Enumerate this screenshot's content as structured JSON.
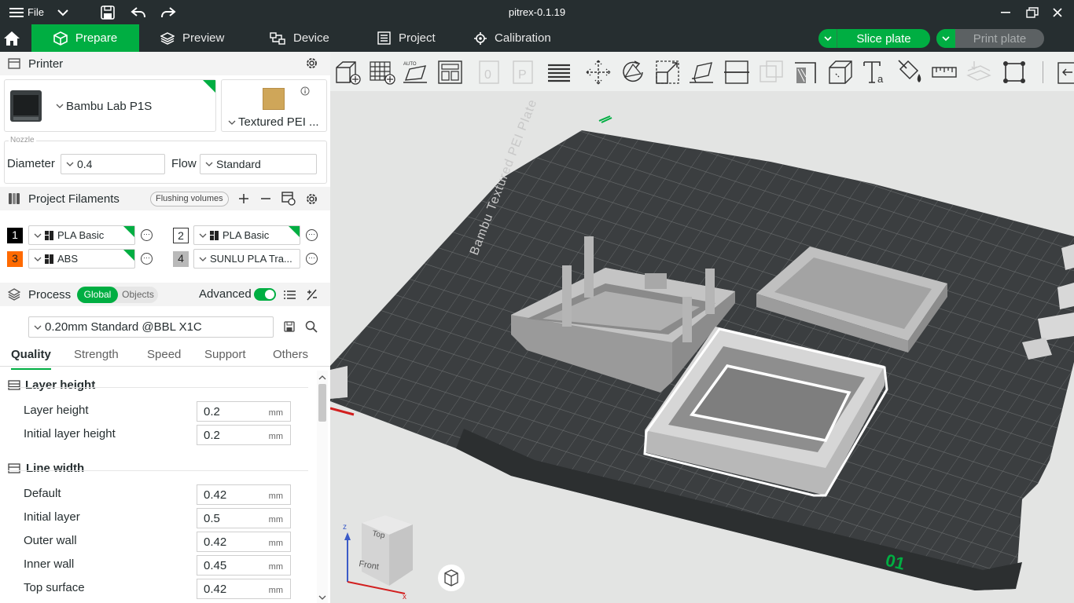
{
  "titlebar": {
    "file_label": "File",
    "title": "pitrex-0.1.19"
  },
  "tabs": {
    "prepare": "Prepare",
    "preview": "Preview",
    "device": "Device",
    "project": "Project",
    "calibration": "Calibration"
  },
  "actions": {
    "slice": "Slice plate",
    "print": "Print plate"
  },
  "printer": {
    "header": "Printer",
    "name": "Bambu Lab P1S",
    "plate": "Textured PEI ...",
    "nozzle_legend": "Nozzle",
    "diameter_label": "Diameter",
    "diameter": "0.4",
    "flow_label": "Flow",
    "flow": "Standard"
  },
  "filaments": {
    "header": "Project Filaments",
    "flushing": "Flushing volumes",
    "items": [
      {
        "num": "1",
        "name": "PLA Basic",
        "color": "#000000"
      },
      {
        "num": "2",
        "name": "PLA Basic",
        "color": "#ffffff"
      },
      {
        "num": "3",
        "name": "ABS",
        "color": "#ff6a00"
      },
      {
        "num": "4",
        "name": "SUNLU PLA Tra...",
        "color": "#b9b9b9"
      }
    ]
  },
  "process": {
    "header": "Process",
    "global": "Global",
    "objects": "Objects",
    "advanced": "Advanced",
    "preset": "0.20mm Standard @BBL X1C",
    "tabs": [
      "Quality",
      "Strength",
      "Speed",
      "Support",
      "Others"
    ]
  },
  "quality": {
    "layer_height_group": "Layer height",
    "layer_height_label": "Layer height",
    "layer_height": "0.2",
    "initial_layer_height_label": "Initial layer height",
    "initial_layer_height": "0.2",
    "line_width_group": "Line width",
    "default_label": "Default",
    "default": "0.42",
    "initial_layer_label": "Initial layer",
    "initial_layer": "0.5",
    "outer_wall_label": "Outer wall",
    "outer_wall": "0.42",
    "inner_wall_label": "Inner wall",
    "inner_wall": "0.45",
    "top_surface_label": "Top surface",
    "top_surface": "0.42",
    "unit": "mm"
  },
  "viewport": {
    "plate_name": "Bambu Textured PEI Plate",
    "plate_number": "01",
    "cube_top": "Top",
    "cube_front": "Front",
    "axis_z": "z",
    "axis_x": "x"
  },
  "colors": {
    "accent": "#00ae42",
    "dark": "#262e30"
  }
}
